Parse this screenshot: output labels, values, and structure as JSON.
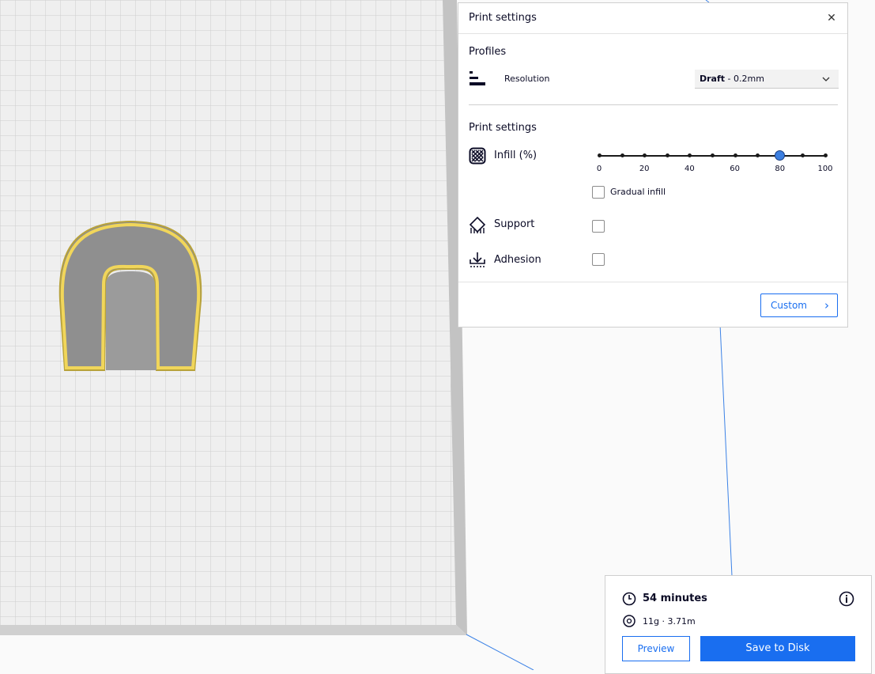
{
  "print_settings": {
    "title": "Print settings",
    "close_glyph": "✕",
    "profiles_section": "Profiles",
    "resolution_label": "Resolution",
    "resolution_value_bold": "Draft",
    "resolution_value_rest": " - 0.2mm",
    "settings_section": "Print settings",
    "infill_label": "Infill (%)",
    "infill_value": 80,
    "infill_ticks": [
      "0",
      "20",
      "40",
      "60",
      "80",
      "100"
    ],
    "gradual_infill_label": "Gradual infill",
    "gradual_infill_checked": false,
    "support_label": "Support",
    "support_checked": false,
    "adhesion_label": "Adhesion",
    "adhesion_checked": false,
    "custom_button": "Custom",
    "custom_arrow": "›"
  },
  "print_info": {
    "time": "54 minutes",
    "material": "11g · 3.71m",
    "preview_button": "Preview",
    "save_button": "Save to Disk"
  },
  "icons": {
    "resolution": "resolution-bars-icon",
    "infill": "infill-pattern-icon",
    "support": "support-icon",
    "adhesion": "adhesion-icon",
    "time": "clock-icon",
    "material": "spool-icon",
    "info": "info-icon",
    "close": "close-icon",
    "dropdown": "chevron-down-icon",
    "custom": "chevron-right-icon"
  },
  "colors": {
    "accent": "#196ef0",
    "slider_handle": "#3c7fe0",
    "model_outline": "#e3c23a",
    "model_body": "#8f8f8f",
    "build_plate": "#efefef",
    "grid_line": "#cdcdcd",
    "volume_edge": "#3c82e6"
  }
}
